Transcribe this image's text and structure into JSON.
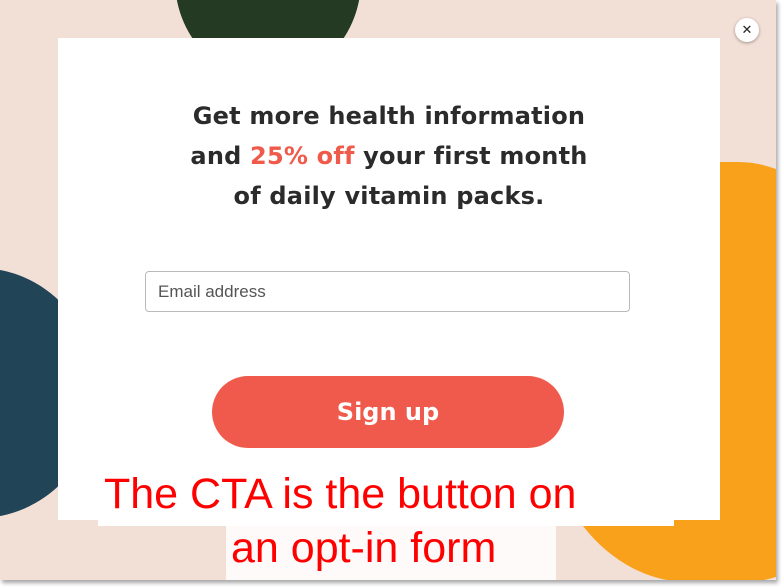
{
  "headline": {
    "line1": "Get more health information",
    "line2_pre": "and ",
    "line2_accent": "25% off",
    "line2_post": " your first month",
    "line3": "of daily vitamin packs."
  },
  "email": {
    "placeholder": "Email address",
    "value": ""
  },
  "signup_label": "Sign up",
  "close_glyph": "✕",
  "caption": {
    "line1": "The CTA is the button on",
    "line2": "an opt-in form"
  },
  "colors": {
    "background": "#f2dfd6",
    "accent": "#ef5a4a",
    "button": "#f05a4c",
    "blob_green": "#243a22",
    "blob_navy": "#214456",
    "blob_orange": "#f9a11b",
    "caption": "#ff0000"
  },
  "icons": {
    "close": "close-icon"
  }
}
